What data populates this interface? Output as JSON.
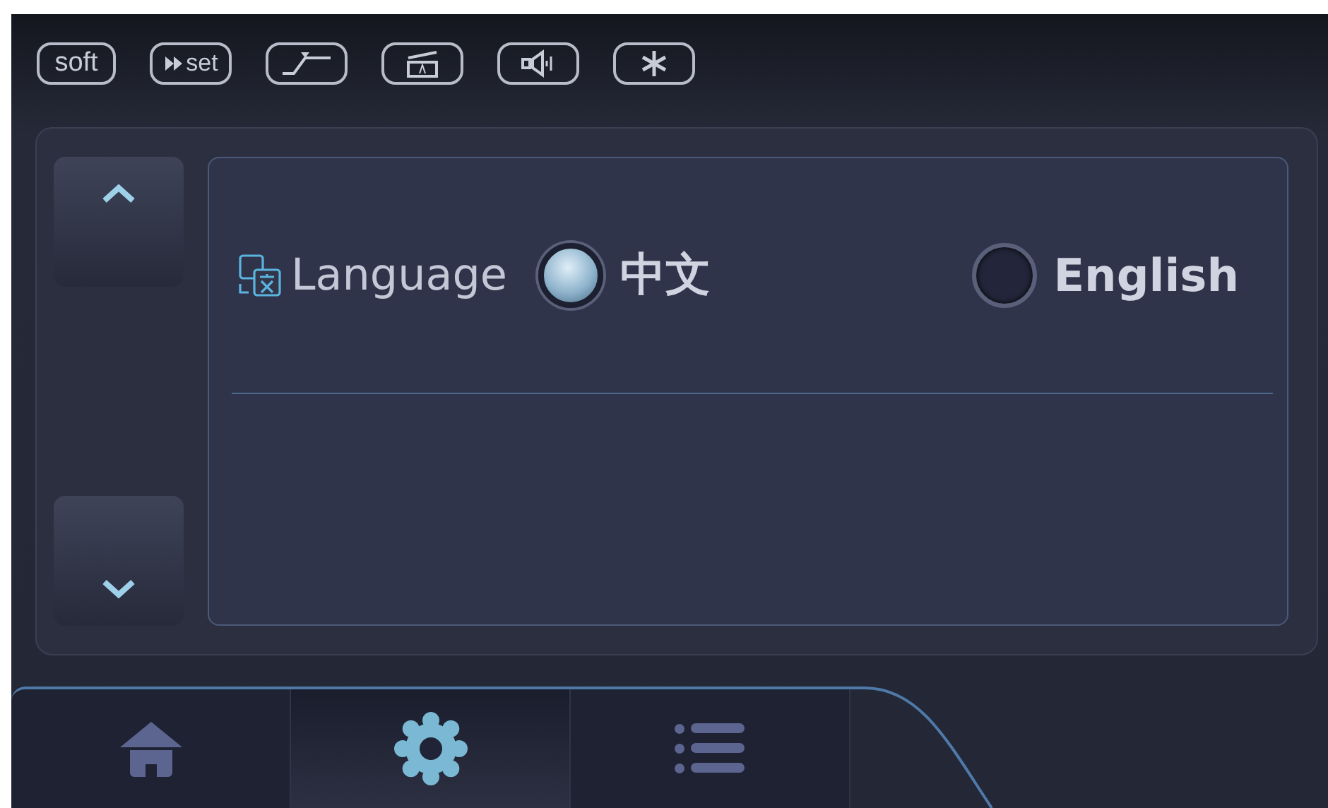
{
  "status_bar": {
    "badges": [
      {
        "kind": "text",
        "label": "soft"
      },
      {
        "kind": "play-text",
        "label": "set"
      },
      {
        "kind": "ramp"
      },
      {
        "kind": "tray"
      },
      {
        "kind": "speaker"
      },
      {
        "kind": "snow"
      }
    ]
  },
  "settings": {
    "label": "Language",
    "options": [
      {
        "label": "中文",
        "selected": true
      },
      {
        "label": "English",
        "selected": false
      }
    ]
  },
  "nav": [
    {
      "kind": "home",
      "selected": false
    },
    {
      "kind": "settings",
      "selected": true
    },
    {
      "kind": "list",
      "selected": false
    }
  ]
}
